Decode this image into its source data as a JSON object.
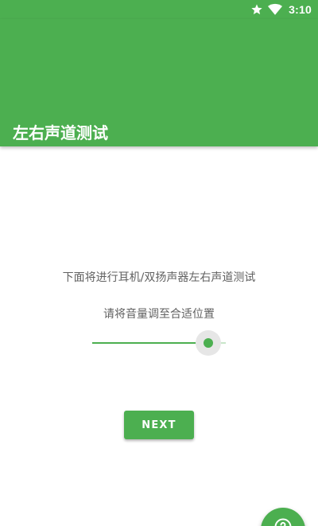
{
  "status_bar": {
    "time": "3:10",
    "icons": [
      "star-icon",
      "wifi-icon"
    ]
  },
  "app_bar": {
    "title": "左右声道测试"
  },
  "main": {
    "description": "下面将进行耳机/双扬声器左右声道测试",
    "instruction": "请将音量调至合适位置",
    "volume_level": 0.87,
    "next_label": "NEXT"
  },
  "fab": {
    "icon": "help-icon"
  },
  "colors": {
    "primary": "#4caf50",
    "text_secondary": "#616161",
    "background": "#ffffff"
  }
}
